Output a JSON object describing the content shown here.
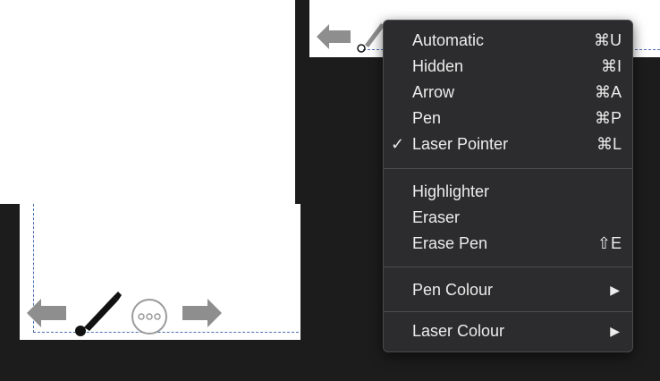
{
  "colors": {
    "background_dark": "#1c1c1c",
    "slide_white": "#ffffff",
    "menu_bg": "#2c2c2e",
    "menu_text": "#ececec",
    "guide_dash": "#4a6fb0",
    "icon_gray": "#8e8e8e"
  },
  "slide_toolbar": {
    "icons": [
      "arrow-left-icon",
      "pen-icon",
      "more-icon",
      "arrow-right-icon"
    ]
  },
  "pointer_menu": {
    "items": [
      {
        "label": "Automatic",
        "shortcut": "⌘U",
        "checked": false
      },
      {
        "label": "Hidden",
        "shortcut": "⌘I",
        "checked": false
      },
      {
        "label": "Arrow",
        "shortcut": "⌘A",
        "checked": false
      },
      {
        "label": "Pen",
        "shortcut": "⌘P",
        "checked": false
      },
      {
        "label": "Laser Pointer",
        "shortcut": "⌘L",
        "checked": true,
        "check_mark": "✓"
      },
      {
        "label": "Highlighter",
        "shortcut": "",
        "checked": false
      },
      {
        "label": "Eraser",
        "shortcut": "",
        "checked": false
      },
      {
        "label": "Erase Pen",
        "shortcut": "⇧E",
        "checked": false
      },
      {
        "label": "Pen Colour",
        "submenu": "▶"
      },
      {
        "label": "Laser Colour",
        "submenu": "▶"
      }
    ]
  }
}
